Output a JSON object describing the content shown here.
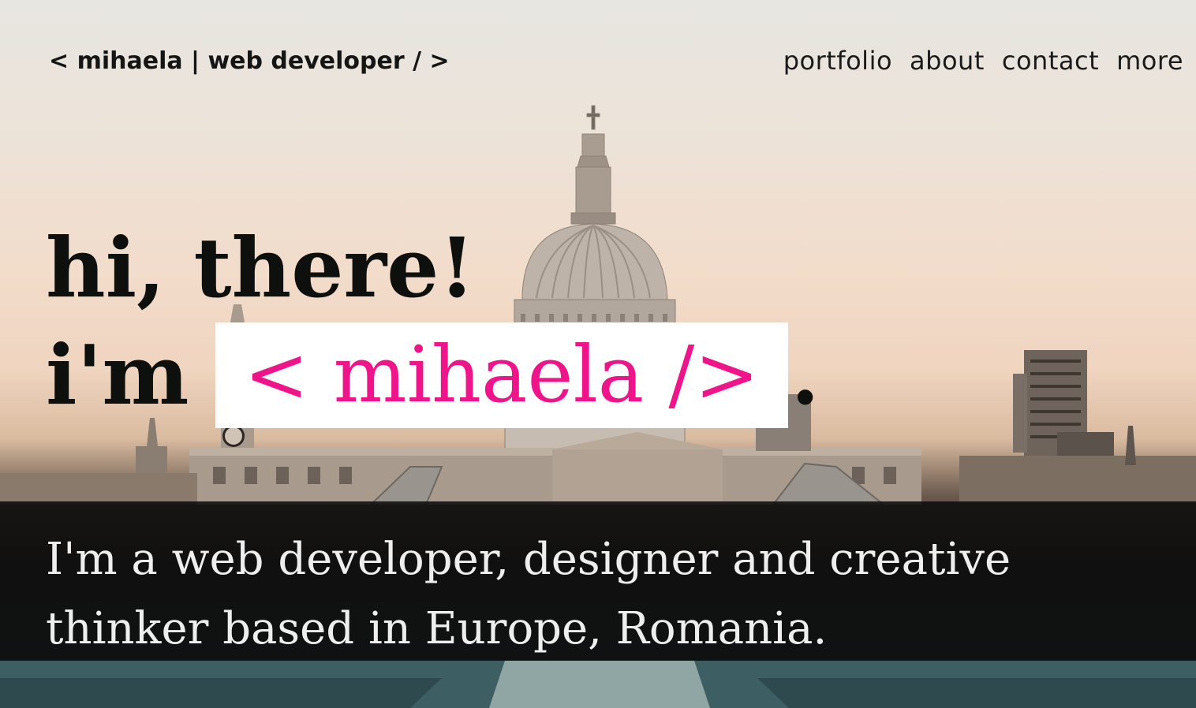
{
  "header": {
    "brand": "< mihaela | web developer / >",
    "nav": [
      {
        "label": "portfolio"
      },
      {
        "label": "about"
      },
      {
        "label": "contact"
      },
      {
        "label": "more"
      }
    ]
  },
  "hero": {
    "greeting": "hi, there!",
    "im": "i'm",
    "name": "< mihaela />",
    "period": ".",
    "intro": "I'm a web developer, designer and creative thinker based in Europe, Romania."
  },
  "colors": {
    "accent": "#f0148a",
    "text_dark": "#0d100c",
    "band": "#0c0c0c"
  }
}
